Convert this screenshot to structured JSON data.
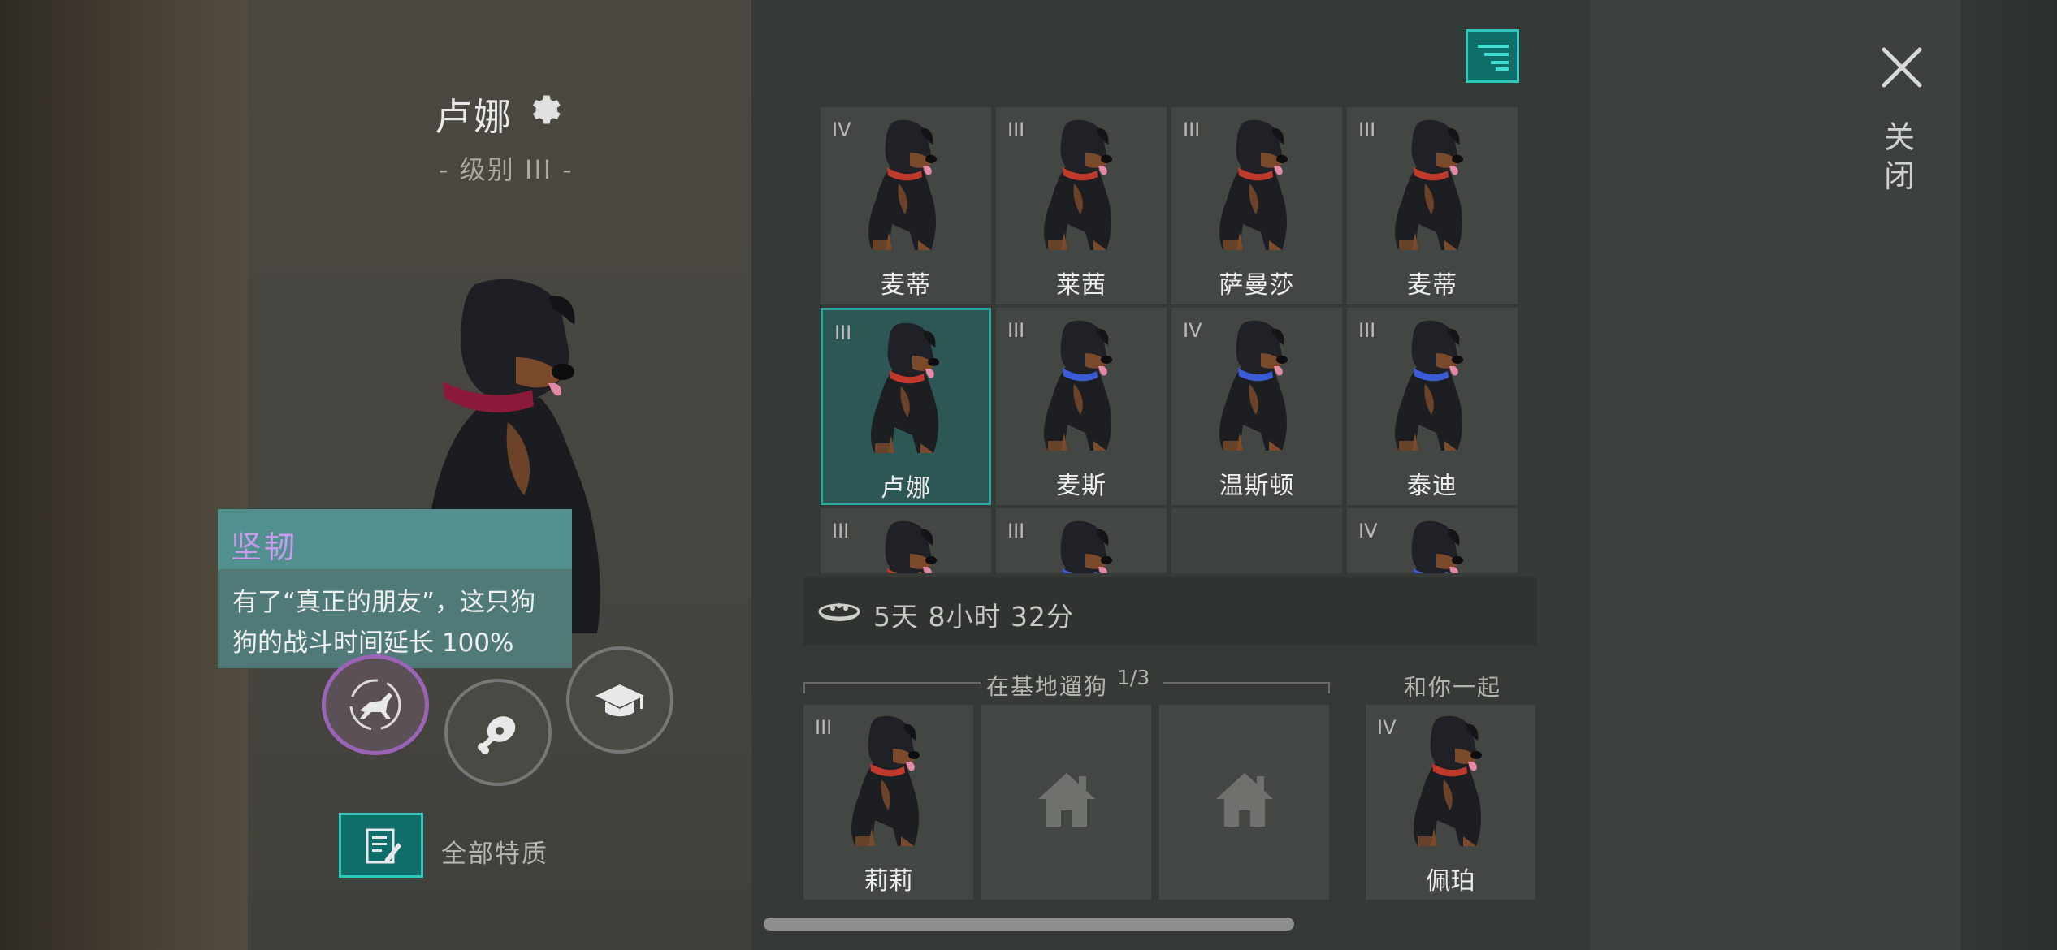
{
  "selected_dog": {
    "name": "卢娜",
    "level": "- 级别 III -"
  },
  "tooltip": {
    "title": "坚韧",
    "lines": [
      "有了“真正的朋友”，这只狗",
      "狗的战斗时间延长 100%"
    ]
  },
  "actions": {
    "walk_icon": "dog-walk-icon",
    "food_icon": "meat-icon",
    "train_icon": "graduation-cap-icon",
    "all_traits_label": "全部特质"
  },
  "grid": [
    {
      "rank": "IV",
      "name": "麦蒂",
      "collar": "#c0392b"
    },
    {
      "rank": "III",
      "name": "莱茜",
      "collar": "#c0392b"
    },
    {
      "rank": "III",
      "name": "萨曼莎",
      "collar": "#c0392b"
    },
    {
      "rank": "III",
      "name": "麦蒂",
      "collar": "#c0392b"
    },
    {
      "rank": "III",
      "name": "卢娜",
      "collar": "#c0392b",
      "selected": true
    },
    {
      "rank": "III",
      "name": "麦斯",
      "collar": "#3b5bd6"
    },
    {
      "rank": "IV",
      "name": "温斯顿",
      "collar": "#3b5bd6"
    },
    {
      "rank": "III",
      "name": "泰迪",
      "collar": "#3b5bd6"
    },
    {
      "rank": "III",
      "name": "",
      "collar": "#c0392b"
    },
    {
      "rank": "III",
      "name": "",
      "collar": "#3b5bd6"
    },
    {
      "rank": "",
      "name": "",
      "empty": true
    },
    {
      "rank": "IV",
      "name": "",
      "collar": "#3b5bd6"
    }
  ],
  "food": {
    "icon": "food-bowl-icon",
    "timer": "5天 8小时 32分"
  },
  "walking": {
    "label": "在基地遛狗",
    "count": "1/3",
    "slots": [
      {
        "rank": "III",
        "name": "莉莉",
        "collar": "#c0392b"
      },
      {
        "empty": true
      },
      {
        "empty": true
      }
    ]
  },
  "with_you": {
    "label": "和你一起",
    "dog": {
      "rank": "IV",
      "name": "佩珀",
      "collar": "#c0392b"
    }
  },
  "close": {
    "chars": [
      "关",
      "闭"
    ]
  },
  "colors": {
    "accent_teal": "#2aa7a0",
    "trait_purple": "#c79cf0"
  }
}
